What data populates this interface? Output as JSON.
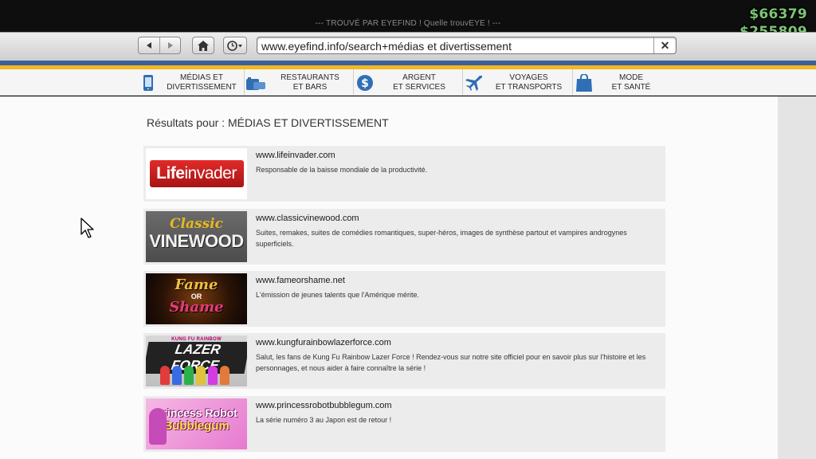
{
  "window": {
    "title": "--- TROUVÉ PAR EYEFIND ! Quelle trouvEYE ! ---"
  },
  "hud": {
    "cash": "$66379",
    "bank": "$255809",
    "cash_color": "#7cc576"
  },
  "toolbar": {
    "back_icon": "back-arrow-icon",
    "forward_icon": "forward-arrow-icon",
    "home_icon": "home-icon",
    "history_icon": "clock-icon",
    "address_value": "www.eyefind.info/search+médias et divertissement",
    "clear_label": "✕"
  },
  "categories": [
    {
      "label": "MÉDIAS ET\nDIVERTISSEMENT",
      "icon": "phone-icon"
    },
    {
      "label": "RESTAURANTS\nET BARS",
      "icon": "restaurant-icon"
    },
    {
      "label": "ARGENT\nET SERVICES",
      "icon": "dollar-coin-icon"
    },
    {
      "label": "VOYAGES\nET TRANSPORTS",
      "icon": "airplane-icon"
    },
    {
      "label": "MODE\nET SANTÉ",
      "icon": "shopping-bag-icon"
    }
  ],
  "results": {
    "heading": "Résultats pour : MÉDIAS ET DIVERTISSEMENT",
    "items": [
      {
        "url": "www.lifeinvader.com",
        "description": "Responsable de la baisse mondiale de la productivité.",
        "logo_part1": "Life",
        "logo_part2": "invader"
      },
      {
        "url": "www.classicvinewood.com",
        "description": "Suites, remakes, suites de comédies romantiques, super-héros, images de synthèse partout et vampires androgynes superficiels.",
        "logo_line1": "Classic",
        "logo_line2": "VINEWOOD"
      },
      {
        "url": "www.fameorshame.net",
        "description": "L'émission de jeunes talents que l'Amérique mérite.",
        "logo_line1": "Fame",
        "logo_line2": "OR",
        "logo_line3": "Shame"
      },
      {
        "url": "www.kungfurainbowlazerforce.com",
        "description": "Salut, les fans de Kung Fu Rainbow Lazer Force ! Rendez-vous sur notre site officiel pour en savoir plus sur l'histoire et les personnages, et nous aider à faire connaître la série !",
        "logo_line1": "KUNG FU RAINBOW",
        "logo_line2": "LAZER FORCE"
      },
      {
        "url": "www.princessrobotbubblegum.com",
        "description": "La série numéro 3 au Japon est de retour !",
        "logo_line1": "Princess Robot",
        "logo_line2": "Bubblegum"
      }
    ]
  }
}
